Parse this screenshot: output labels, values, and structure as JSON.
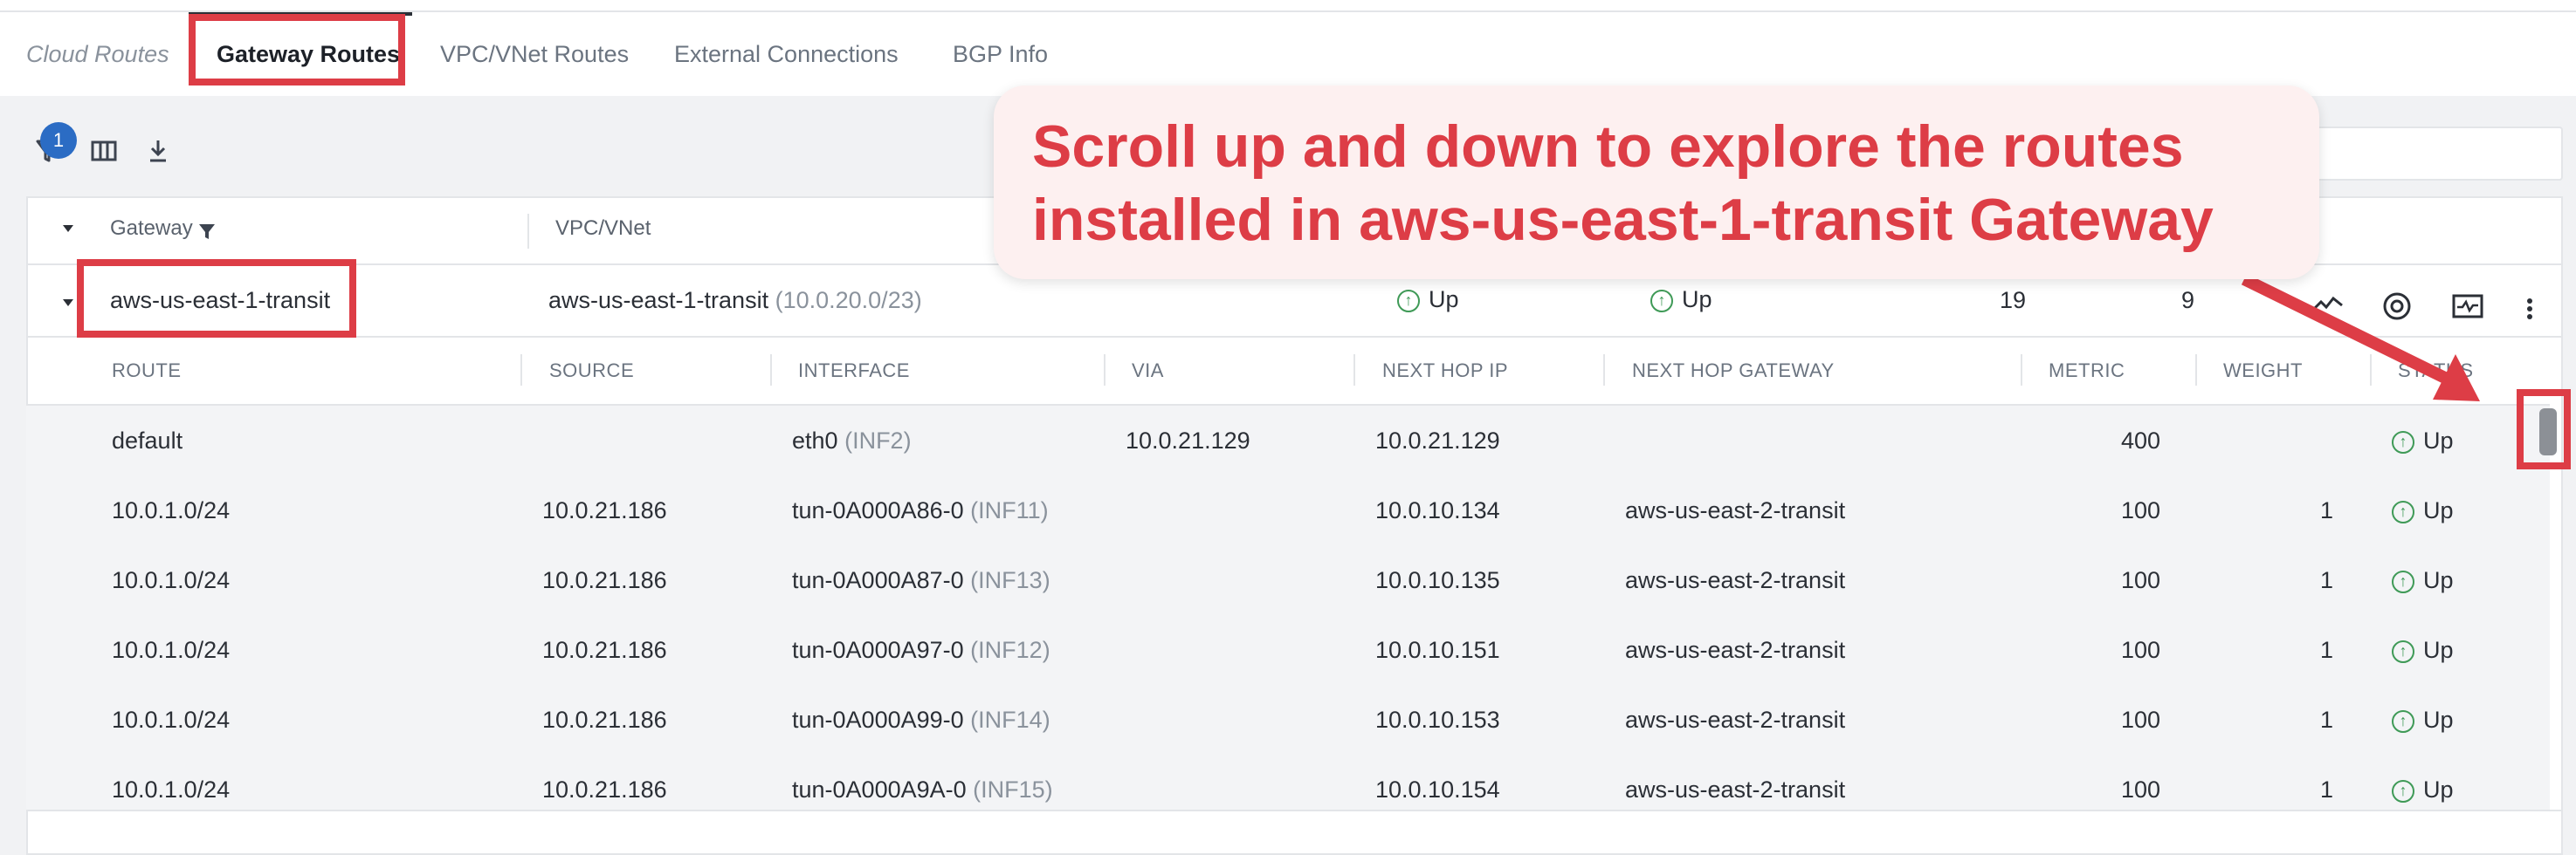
{
  "tabs": [
    "Cloud Routes",
    "Gateway Routes",
    "VPC/VNet Routes",
    "External Connections",
    "BGP Info"
  ],
  "toolbar": {
    "filter_badge": "1",
    "icons": [
      "filter-icon",
      "columns-icon",
      "download-icon"
    ]
  },
  "table": {
    "headers": {
      "gateway": "Gateway",
      "vpc": "VPC/VNet"
    },
    "gateway_row": {
      "gateway": "aws-us-east-1-transit",
      "vpc": "aws-us-east-1-transit",
      "vpc_cidr": "(10.0.20.0/23)",
      "status1": "Up",
      "status2": "Up",
      "count1": "19",
      "count2": "9"
    }
  },
  "routes": {
    "headers": [
      "ROUTE",
      "SOURCE",
      "INTERFACE",
      "VIA",
      "NEXT HOP IP",
      "NEXT HOP GATEWAY",
      "METRIC",
      "WEIGHT",
      "STATUS"
    ],
    "rows": [
      {
        "route": "default",
        "source": "",
        "interface": "eth0",
        "interface_id": "(INF2)",
        "via": "10.0.21.129",
        "next_hop_ip": "10.0.21.129",
        "next_hop_gateway": "",
        "metric": "400",
        "weight": "",
        "status": "Up"
      },
      {
        "route": "10.0.1.0/24",
        "source": "10.0.21.186",
        "interface": "tun-0A000A86-0",
        "interface_id": "(INF11)",
        "via": "",
        "next_hop_ip": "10.0.10.134",
        "next_hop_gateway": "aws-us-east-2-transit",
        "metric": "100",
        "weight": "1",
        "status": "Up"
      },
      {
        "route": "10.0.1.0/24",
        "source": "10.0.21.186",
        "interface": "tun-0A000A87-0",
        "interface_id": "(INF13)",
        "via": "",
        "next_hop_ip": "10.0.10.135",
        "next_hop_gateway": "aws-us-east-2-transit",
        "metric": "100",
        "weight": "1",
        "status": "Up"
      },
      {
        "route": "10.0.1.0/24",
        "source": "10.0.21.186",
        "interface": "tun-0A000A97-0",
        "interface_id": "(INF12)",
        "via": "",
        "next_hop_ip": "10.0.10.151",
        "next_hop_gateway": "aws-us-east-2-transit",
        "metric": "100",
        "weight": "1",
        "status": "Up"
      },
      {
        "route": "10.0.1.0/24",
        "source": "10.0.21.186",
        "interface": "tun-0A000A99-0",
        "interface_id": "(INF14)",
        "via": "",
        "next_hop_ip": "10.0.10.153",
        "next_hop_gateway": "aws-us-east-2-transit",
        "metric": "100",
        "weight": "1",
        "status": "Up"
      },
      {
        "route": "10.0.1.0/24",
        "source": "10.0.21.186",
        "interface": "tun-0A000A9A-0",
        "interface_id": "(INF15)",
        "via": "",
        "next_hop_ip": "10.0.10.154",
        "next_hop_gateway": "aws-us-east-2-transit",
        "metric": "100",
        "weight": "1",
        "status": "Up"
      }
    ]
  },
  "callout": {
    "line1": "Scroll up and down to explore the routes",
    "line2": "installed in aws-us-east-1-transit Gateway"
  },
  "colors": {
    "annotation_red": "#dd3d46",
    "status_green": "#3f9a57",
    "badge_blue": "#2b6cc4"
  }
}
